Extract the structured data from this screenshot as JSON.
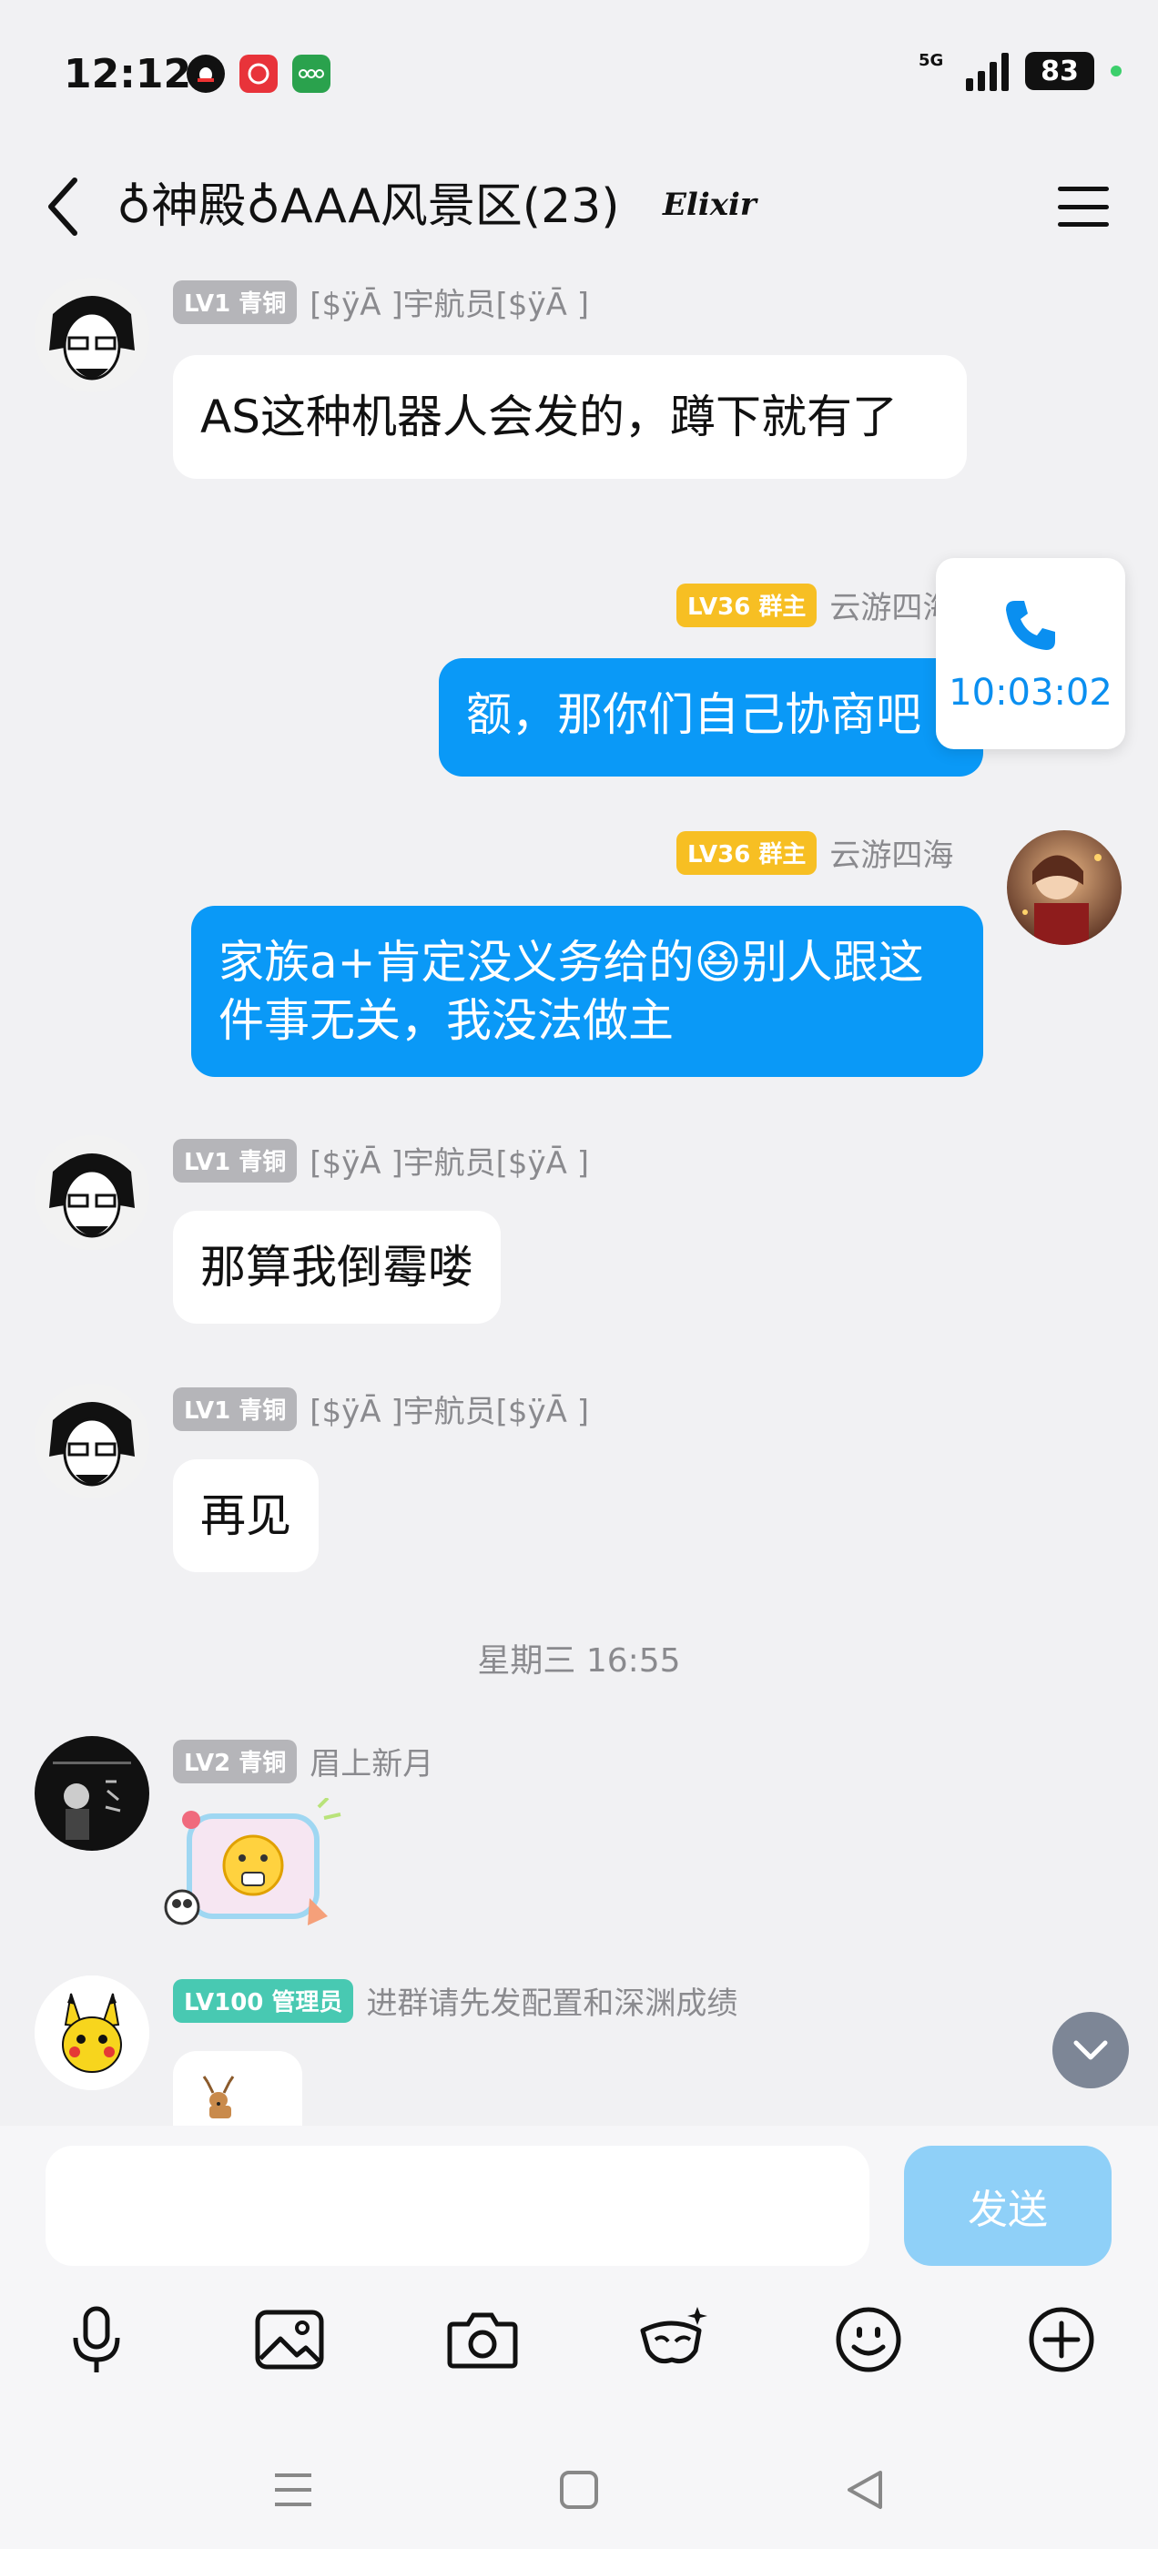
{
  "status_bar": {
    "time": "12:12",
    "network": "5G",
    "battery": "83",
    "apps": [
      "qq-icon",
      "app-red-icon",
      "oppo-icon"
    ]
  },
  "header": {
    "title": "♁神殿♁AAA风景区(23)",
    "badge": "Elixir"
  },
  "messages": [
    {
      "level": "LV1 青铜",
      "nickname": "[$ÿĀ ]宇航员[$ÿĀ ]",
      "text": "AS这种机器人会发的，蹲下就有了"
    },
    {
      "level": "LV36 群主",
      "nickname": "云游四海",
      "text": "额，那你们自己协商吧"
    },
    {
      "level": "LV36 群主",
      "nickname": "云游四海",
      "text": "家族a+肯定没义务给的😆别人跟这件事无关，我没法做主"
    },
    {
      "level": "LV1 青铜",
      "nickname": "[$ÿĀ ]宇航员[$ÿĀ ]",
      "text": "那算我倒霉喽"
    },
    {
      "level": "LV1 青铜",
      "nickname": "[$ÿĀ ]宇航员[$ÿĀ ]",
      "text": "再见"
    },
    {
      "level": "LV2 青铜",
      "nickname": "眉上新月",
      "text": ""
    },
    {
      "level": "LV100 管理员",
      "nickname": "进群请先发配置和深渊成绩",
      "text": ""
    }
  ],
  "time_divider": "星期三 16:55",
  "call_widget": {
    "duration": "10:03:02"
  },
  "input": {
    "placeholder": "",
    "send_label": "发送"
  },
  "colors": {
    "blue_bubble": "#0a99f7",
    "gold_badge": "#f7bf23",
    "gray_badge": "#b5b5b9",
    "teal_badge": "#48c9b2"
  }
}
